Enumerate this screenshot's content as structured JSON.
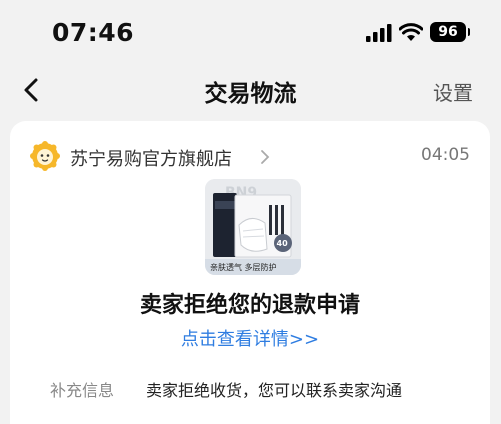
{
  "status_bar": {
    "time": "07:46",
    "battery": "96"
  },
  "nav": {
    "title": "交易物流",
    "settings": "设置"
  },
  "message": {
    "store_name": "苏宁易购官方旗舰店",
    "time": "04:05",
    "product_badge": "40",
    "product_caption": "亲肤透气 多层防护",
    "title": "卖家拒绝您的退款申请",
    "detail_link": "点击查看详情>>",
    "extra_label": "补充信息",
    "extra_value": "卖家拒绝收货，您可以联系卖家沟通"
  },
  "colors": {
    "link": "#2f7de1",
    "logo": "#f6b72a"
  }
}
